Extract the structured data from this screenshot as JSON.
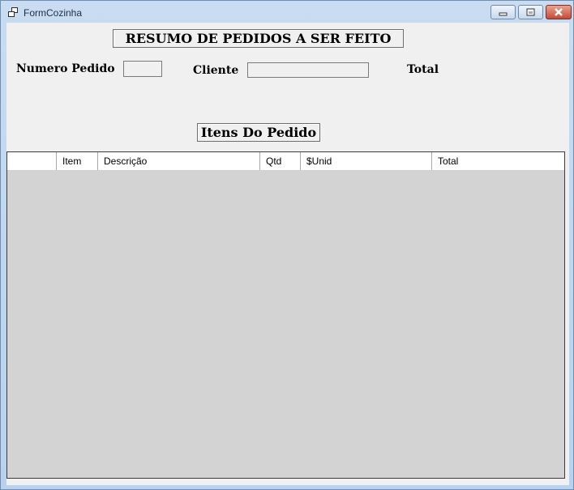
{
  "window": {
    "title": "FormCozinha"
  },
  "form": {
    "heading": "RESUMO DE PEDIDOS A SER FEITO",
    "numero_pedido_label": "Numero Pedido",
    "numero_pedido_value": "",
    "cliente_label": "Cliente",
    "cliente_value": "",
    "total_label": "Total",
    "itens_heading": "Itens Do Pedido"
  },
  "grid": {
    "columns": [
      "",
      "Item",
      "Descrição",
      "Qtd",
      "$Unid",
      "Total"
    ],
    "rows": []
  },
  "colors": {
    "grid_background": "#d3d3d3",
    "form_background": "#f0f0f0"
  }
}
